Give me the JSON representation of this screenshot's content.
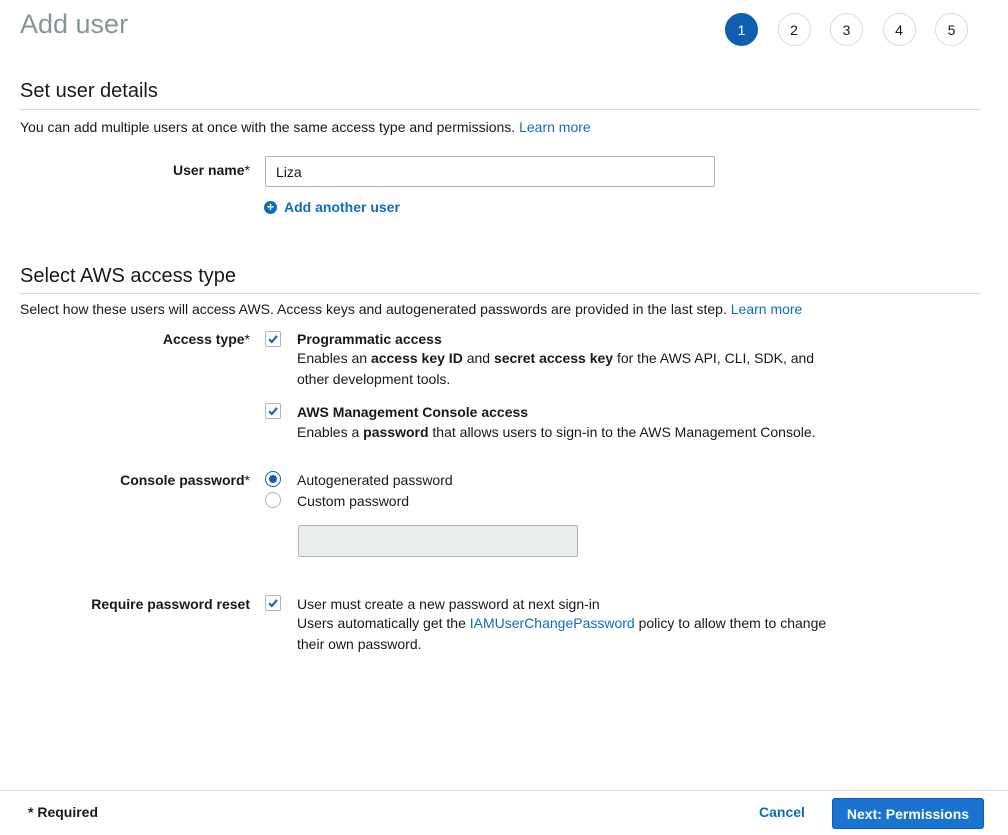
{
  "header": {
    "title": "Add user",
    "steps": [
      "1",
      "2",
      "3",
      "4",
      "5"
    ],
    "active_step": "1"
  },
  "details": {
    "heading": "Set user details",
    "description": "You can add multiple users at once with the same access type and permissions.",
    "learn_more": "Learn more",
    "user_name_label": "User name",
    "required_mark": "*",
    "user_name_value": "Liza",
    "add_another_user": "Add another user"
  },
  "access": {
    "heading": "Select AWS access type",
    "description": "Select how these users will access AWS. Access keys and autogenerated passwords are provided in the last step.",
    "learn_more": "Learn more",
    "access_type_label": "Access type",
    "programmatic": {
      "title": "Programmatic access",
      "checked": true,
      "desc_1": "Enables an ",
      "desc_bold_1": "access key ID",
      "desc_2": " and ",
      "desc_bold_2": "secret access key",
      "desc_3": " for the AWS API, CLI, SDK, and other development tools."
    },
    "console": {
      "title": "AWS Management Console access",
      "checked": true,
      "desc_1": "Enables a ",
      "desc_bold_1": "password",
      "desc_2": " that allows users to sign-in to the AWS Management Console."
    },
    "console_password_label": "Console password",
    "password_options": [
      "Autogenerated password",
      "Custom password"
    ],
    "selected_password_option": "Autogenerated password",
    "require_reset_label": "Require password reset",
    "require_reset_checked": true,
    "require_reset_title": "User must create a new password at next sign-in",
    "require_reset_desc_1": "Users automatically get the ",
    "require_reset_link": "IAMUserChangePassword",
    "require_reset_desc_2": " policy to allow them to change their own password."
  },
  "footer": {
    "required_note": "* Required",
    "cancel": "Cancel",
    "next": "Next: Permissions"
  },
  "colors": {
    "accent": "#0f5eb1",
    "link": "#0f6bbf",
    "primary_button": "#1a73d0"
  }
}
